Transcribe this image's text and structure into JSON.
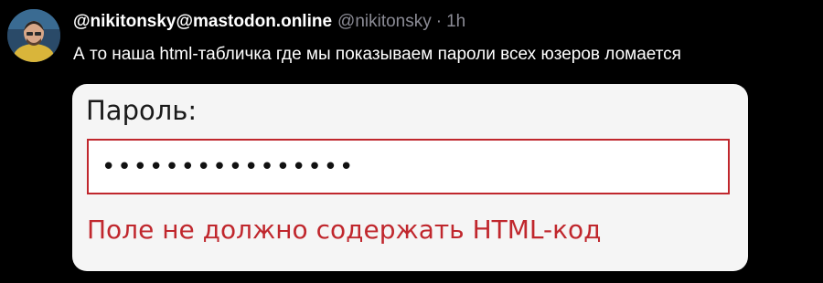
{
  "post": {
    "display_name": "@nikitonsky@mastodon.online",
    "handle": "@nikitonsky",
    "separator": "·",
    "time": "1h",
    "text": "А то наша html-табличка где мы показываем пароли всех юзеров ломается"
  },
  "avatar": {
    "icon": "avatar-photo"
  },
  "media": {
    "label": "Пароль:",
    "password_value": "••••••••••••••••",
    "error": "Поле не должно содержать HTML-код",
    "error_color": "#c0272d"
  }
}
